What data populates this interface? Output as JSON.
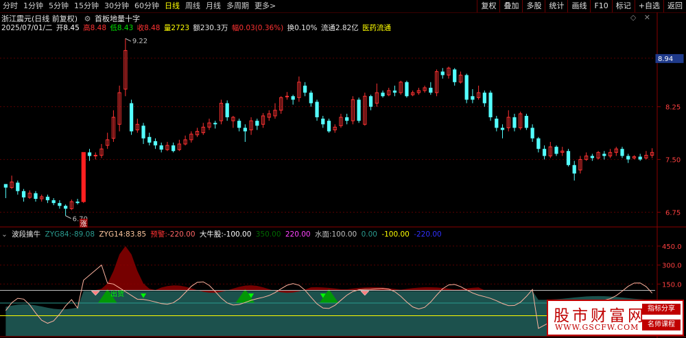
{
  "menu": {
    "items": [
      "分时",
      "1分钟",
      "5分钟",
      "15分钟",
      "30分钟",
      "60分钟",
      "日线",
      "周线",
      "月线",
      "多周期",
      "更多>"
    ],
    "active_index": 6
  },
  "toolbar": {
    "buttons": [
      "复权",
      "叠加",
      "多股",
      "统计",
      "画线",
      "F10",
      "标记",
      "+自选",
      "返回"
    ]
  },
  "header": {
    "title": "浙江震元(日线 前复权)",
    "subtitle_icon": "settings-icon",
    "chart_title": "首板地量十字"
  },
  "quote": {
    "date": "2025/07/01/二",
    "open_label": "开",
    "open": "8.45",
    "high_label": "高",
    "high": "8.48",
    "low_label": "低",
    "low": "8.43",
    "close_label": "收",
    "close": "8.48",
    "volume_label": "量",
    "volume": "2723",
    "amount_label": "额",
    "amount": "230.3万",
    "change_label": "幅",
    "change": "0.03(0.36%)",
    "turnover_label": "换",
    "turnover": "0.10%",
    "float_label": "流通",
    "float": "2.82亿",
    "sector": "医药流通"
  },
  "price_axis": {
    "ticks": [
      "8.94",
      "8.25",
      "7.50",
      "6.75"
    ],
    "current": "8.94"
  },
  "annotations": {
    "high": "9.22",
    "low": "6.70",
    "limit_up": "涨"
  },
  "indicator": {
    "name": "波段擒牛",
    "zyg84_label": "ZYG84:",
    "zyg84": "-89.08",
    "zyg14_label": "ZYG14:",
    "zyg14": "83.85",
    "warn_label": "预警:",
    "warn": "-220.00",
    "bull_label": "大牛股:",
    "bull": "-100.00",
    "v350": "350.00",
    "v220": "220.00",
    "water_label": "水面:",
    "water": "100.00",
    "v0": "0.00",
    "vneg100": "-100.00",
    "vneg220": "-220.00",
    "axis": [
      "450.0",
      "300.0",
      "150.0"
    ],
    "exit_label": "出货"
  },
  "colors": {
    "up": "#ff3232",
    "down": "#54ffff",
    "accent": "#ffff00",
    "bg": "#000000"
  },
  "logo": {
    "main": "股市财富网",
    "sub": "WWW.GSCFW.COM",
    "tag1": "指标分享",
    "tag2": "名师课程"
  },
  "chart_data": {
    "type": "candlestick",
    "ylim": [
      6.55,
      9.3
    ],
    "candles": [
      [
        7.15,
        7.1,
        7.12,
        6.95
      ],
      [
        7.1,
        7.18,
        7.27,
        7.08
      ],
      [
        7.17,
        7.05,
        7.2,
        7.0
      ],
      [
        7.05,
        6.96,
        7.08,
        6.9
      ],
      [
        6.96,
        7.02,
        7.06,
        6.94
      ],
      [
        7.02,
        6.94,
        7.05,
        6.9
      ],
      [
        6.94,
        6.97,
        7.0,
        6.9
      ],
      [
        6.97,
        6.92,
        7.0,
        6.88
      ],
      [
        6.92,
        6.88,
        6.95,
        6.85
      ],
      [
        6.88,
        6.84,
        6.92,
        6.8
      ],
      [
        6.84,
        6.8,
        6.86,
        6.7
      ],
      [
        6.8,
        6.9,
        6.93,
        6.78
      ],
      [
        6.9,
        6.88,
        6.94,
        6.86
      ],
      [
        6.9,
        7.6,
        7.6,
        6.88
      ],
      [
        7.6,
        7.55,
        7.65,
        7.48
      ],
      [
        7.55,
        7.56,
        7.6,
        7.5
      ],
      [
        7.56,
        7.65,
        7.72,
        7.52
      ],
      [
        7.7,
        7.78,
        7.88,
        7.65
      ],
      [
        7.8,
        8.1,
        8.2,
        7.75
      ],
      [
        8.0,
        8.45,
        8.55,
        7.9
      ],
      [
        8.5,
        9.05,
        9.22,
        8.4
      ],
      [
        8.3,
        7.9,
        8.35,
        7.85
      ],
      [
        7.92,
        8.0,
        8.08,
        7.88
      ],
      [
        7.98,
        7.8,
        8.02,
        7.72
      ],
      [
        7.82,
        7.74,
        7.88,
        7.7
      ],
      [
        7.76,
        7.7,
        7.8,
        7.65
      ],
      [
        7.7,
        7.64,
        7.74,
        7.6
      ],
      [
        7.64,
        7.7,
        7.75,
        7.62
      ],
      [
        7.7,
        7.62,
        7.74,
        7.6
      ],
      [
        7.64,
        7.72,
        7.78,
        7.62
      ],
      [
        7.72,
        7.78,
        7.84,
        7.7
      ],
      [
        7.78,
        7.86,
        7.9,
        7.74
      ],
      [
        7.85,
        7.9,
        7.95,
        7.82
      ],
      [
        7.88,
        7.96,
        8.02,
        7.85
      ],
      [
        7.96,
        8.02,
        8.08,
        7.92
      ],
      [
        8.02,
        8.0,
        8.05,
        7.94
      ],
      [
        8.05,
        8.3,
        8.35,
        8.0
      ],
      [
        8.3,
        8.1,
        8.34,
        8.05
      ],
      [
        8.05,
        8.1,
        8.12,
        7.95
      ],
      [
        8.05,
        7.95,
        8.08,
        7.9
      ],
      [
        7.95,
        7.9,
        8.0,
        7.75
      ],
      [
        7.92,
        8.05,
        8.1,
        7.85
      ],
      [
        8.05,
        7.98,
        8.08,
        7.92
      ],
      [
        8.0,
        8.12,
        8.16,
        7.95
      ],
      [
        8.1,
        8.15,
        8.2,
        8.05
      ],
      [
        8.12,
        8.2,
        8.3,
        8.08
      ],
      [
        8.2,
        8.38,
        8.4,
        8.15
      ],
      [
        8.4,
        8.4,
        8.46,
        8.35
      ],
      [
        8.4,
        8.35,
        8.42,
        8.28
      ],
      [
        8.38,
        8.6,
        8.68,
        8.32
      ],
      [
        8.55,
        8.45,
        8.6,
        8.4
      ],
      [
        8.45,
        8.3,
        8.48,
        8.25
      ],
      [
        8.32,
        8.1,
        8.35,
        8.05
      ],
      [
        8.08,
        8.0,
        8.12,
        7.95
      ],
      [
        8.05,
        7.9,
        8.08,
        7.88
      ],
      [
        7.92,
        7.96,
        8.0,
        7.88
      ],
      [
        7.98,
        8.1,
        8.15,
        7.95
      ],
      [
        8.1,
        8.05,
        8.15,
        8.0
      ],
      [
        8.05,
        8.35,
        8.4,
        8.0
      ],
      [
        8.35,
        8.05,
        8.38,
        8.02
      ],
      [
        8.0,
        8.4,
        8.45,
        7.98
      ],
      [
        8.4,
        8.25,
        8.42,
        8.2
      ],
      [
        8.3,
        8.45,
        8.58,
        8.25
      ],
      [
        8.45,
        8.4,
        8.48,
        8.38
      ],
      [
        8.42,
        8.48,
        8.52,
        8.4
      ],
      [
        8.48,
        8.45,
        8.55,
        8.4
      ],
      [
        8.45,
        8.6,
        8.62,
        8.42
      ],
      [
        8.6,
        8.4,
        8.62,
        8.38
      ],
      [
        8.42,
        8.45,
        8.48,
        8.4
      ],
      [
        8.45,
        8.48,
        8.52,
        8.42
      ],
      [
        8.48,
        8.52,
        8.55,
        8.45
      ],
      [
        8.52,
        8.45,
        8.6,
        8.42
      ],
      [
        8.45,
        8.75,
        8.78,
        8.4
      ],
      [
        8.75,
        8.7,
        8.8,
        8.65
      ],
      [
        8.7,
        8.8,
        8.82,
        8.65
      ],
      [
        8.78,
        8.6,
        8.8,
        8.55
      ],
      [
        8.6,
        8.7,
        8.75,
        8.58
      ],
      [
        8.7,
        8.35,
        8.72,
        8.3
      ],
      [
        8.4,
        8.35,
        8.5,
        8.3
      ],
      [
        8.38,
        8.45,
        8.55,
        8.35
      ],
      [
        8.45,
        8.3,
        8.48,
        8.25
      ],
      [
        8.45,
        8.1,
        8.48,
        8.05
      ],
      [
        8.08,
        7.95,
        8.12,
        7.9
      ],
      [
        7.95,
        7.92,
        8.0,
        7.8
      ],
      [
        7.95,
        8.1,
        8.2,
        7.9
      ],
      [
        8.1,
        7.95,
        8.15,
        7.9
      ],
      [
        7.95,
        8.15,
        8.18,
        7.92
      ],
      [
        8.12,
        7.95,
        8.15,
        7.92
      ],
      [
        7.95,
        7.8,
        8.0,
        7.75
      ],
      [
        7.8,
        7.65,
        7.82,
        7.6
      ],
      [
        7.65,
        7.55,
        7.7,
        7.5
      ],
      [
        7.55,
        7.68,
        7.75,
        7.52
      ],
      [
        7.68,
        7.58,
        7.7,
        7.55
      ],
      [
        7.6,
        7.62,
        7.68,
        7.55
      ],
      [
        7.62,
        7.42,
        7.65,
        7.4
      ],
      [
        7.42,
        7.3,
        7.48,
        7.2
      ],
      [
        7.35,
        7.5,
        7.55,
        7.3
      ],
      [
        7.5,
        7.55,
        7.6,
        7.48
      ],
      [
        7.55,
        7.52,
        7.58,
        7.48
      ],
      [
        7.52,
        7.6,
        7.62,
        7.5
      ],
      [
        7.58,
        7.55,
        7.62,
        7.5
      ],
      [
        7.55,
        7.6,
        7.65,
        7.52
      ],
      [
        7.6,
        7.65,
        7.68,
        7.55
      ],
      [
        7.65,
        7.55,
        7.68,
        7.52
      ],
      [
        7.55,
        7.5,
        7.58,
        7.45
      ],
      [
        7.52,
        7.54,
        7.56,
        7.5
      ],
      [
        7.54,
        7.5,
        7.58,
        7.48
      ],
      [
        7.52,
        7.56,
        7.62,
        7.5
      ],
      [
        7.56,
        7.6,
        7.66,
        7.52
      ]
    ],
    "indicator_axis_range": [
      -260,
      520
    ]
  }
}
